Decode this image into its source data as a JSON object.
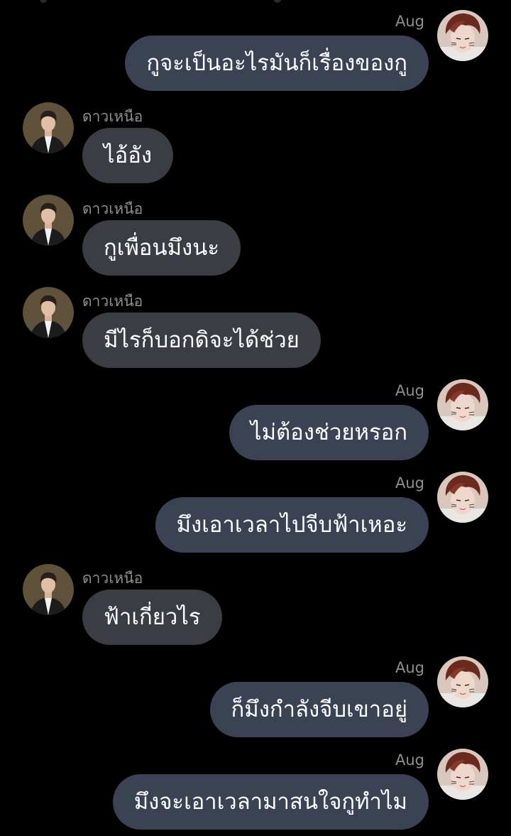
{
  "colors": {
    "background": "#000000",
    "sent_bubble": "#3a4253",
    "received_bubble": "#3b3d44",
    "name_text": "#8e8e93",
    "message_text": "#ffffff"
  },
  "participants": {
    "me": {
      "name": "Aug",
      "avatar": "avatar-aug-icon"
    },
    "other": {
      "name": "ดาวเหนือ",
      "avatar": "avatar-daonuea-icon"
    }
  },
  "messages": [
    {
      "side": "right",
      "sender": "Aug",
      "text": "กูจะเป็นอะไรมันก็เรื่องของกู"
    },
    {
      "side": "left",
      "sender": "ดาวเหนือ",
      "text": "ไอ้อัง"
    },
    {
      "side": "left",
      "sender": "ดาวเหนือ",
      "text": "กูเพื่อนมึงนะ"
    },
    {
      "side": "left",
      "sender": "ดาวเหนือ",
      "text": "มีไรก็บอกดิจะได้ช่วย"
    },
    {
      "side": "right",
      "sender": "Aug",
      "text": "ไม่ต้องช่วยหรอก"
    },
    {
      "side": "right",
      "sender": "Aug",
      "text": "มึงเอาเวลาไปจีบฟ้าเหอะ"
    },
    {
      "side": "left",
      "sender": "ดาวเหนือ",
      "text": "ฟ้าเกี่ยวไร"
    },
    {
      "side": "right",
      "sender": "Aug",
      "text": "ก็มึงกำลังจีบเขาอยู่"
    },
    {
      "side": "right",
      "sender": "Aug",
      "text": "มึงจะเอาเวลามาสนใจกูทำไม"
    }
  ]
}
